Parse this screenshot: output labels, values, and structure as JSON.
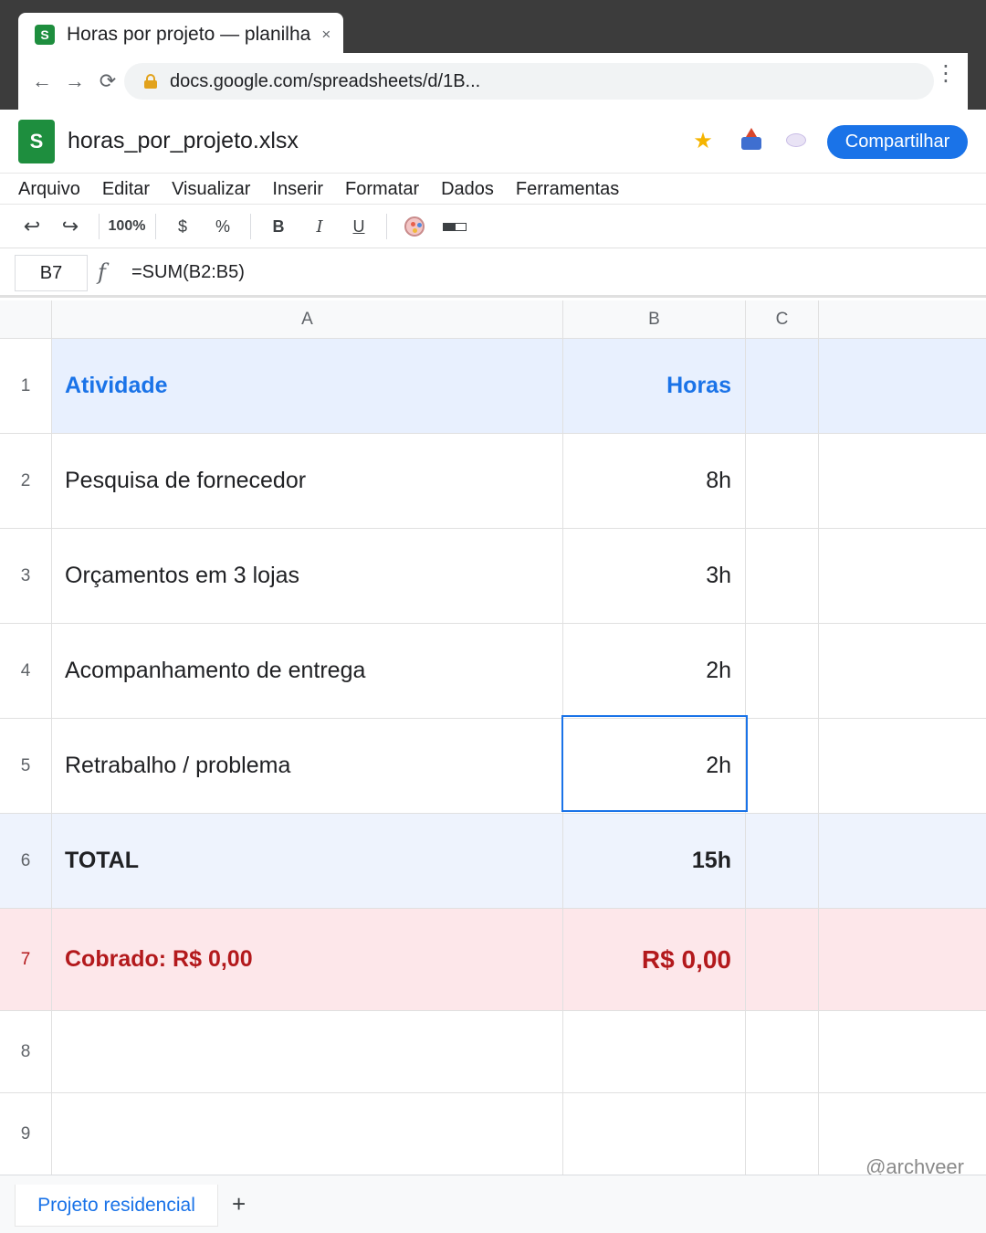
{
  "browser": {
    "tab_title": "Horas por projeto — planilha",
    "tab_close": "×",
    "favicon": "S",
    "url": "docs.google.com/spreadsheets/d/1B...",
    "back": "←",
    "forward": "→",
    "reload": "⟳",
    "menu": "⋮"
  },
  "app": {
    "logo": "S",
    "title": "horas_por_projeto.xlsx",
    "share_label": "Compartilhar",
    "star": "★",
    "accent": "#1a73e8"
  },
  "menu": [
    "Arquivo",
    "Editar",
    "Visualizar",
    "Inserir",
    "Formatar",
    "Dados",
    "Ferramentas"
  ],
  "toolbar": {
    "undo": "↩",
    "redo": "↪",
    "zoom": "100%",
    "currency": "$",
    "percent": "%",
    "bold": "B",
    "italic": "I",
    "underline": "U"
  },
  "formula_bar": {
    "cell_ref": "B7",
    "fx": "f",
    "formula": "=SUM(B2:B5)"
  },
  "columns": [
    "A",
    "B",
    "C"
  ],
  "rows": [
    {
      "num": "1",
      "a": "Atividade",
      "b": "Horas"
    },
    {
      "num": "2",
      "a": "Pesquisa de fornecedor",
      "b": "8h"
    },
    {
      "num": "3",
      "a": "Orçamentos em 3 lojas",
      "b": "3h"
    },
    {
      "num": "4",
      "a": "Acompanhamento de entrega",
      "b": "2h"
    },
    {
      "num": "5",
      "a": "Retrabalho / problema",
      "b": "2h"
    },
    {
      "num": "6",
      "a": "TOTAL",
      "b": "15h"
    },
    {
      "num": "7",
      "a": "Cobrado: R$ 0,00",
      "b": "R$ 0,00"
    },
    {
      "num": "8",
      "a": "",
      "b": ""
    },
    {
      "num": "9",
      "a": "",
      "b": ""
    }
  ],
  "sheet_tabs": {
    "active": "Projeto residencial",
    "add": "+"
  },
  "watermark": "@archveer"
}
